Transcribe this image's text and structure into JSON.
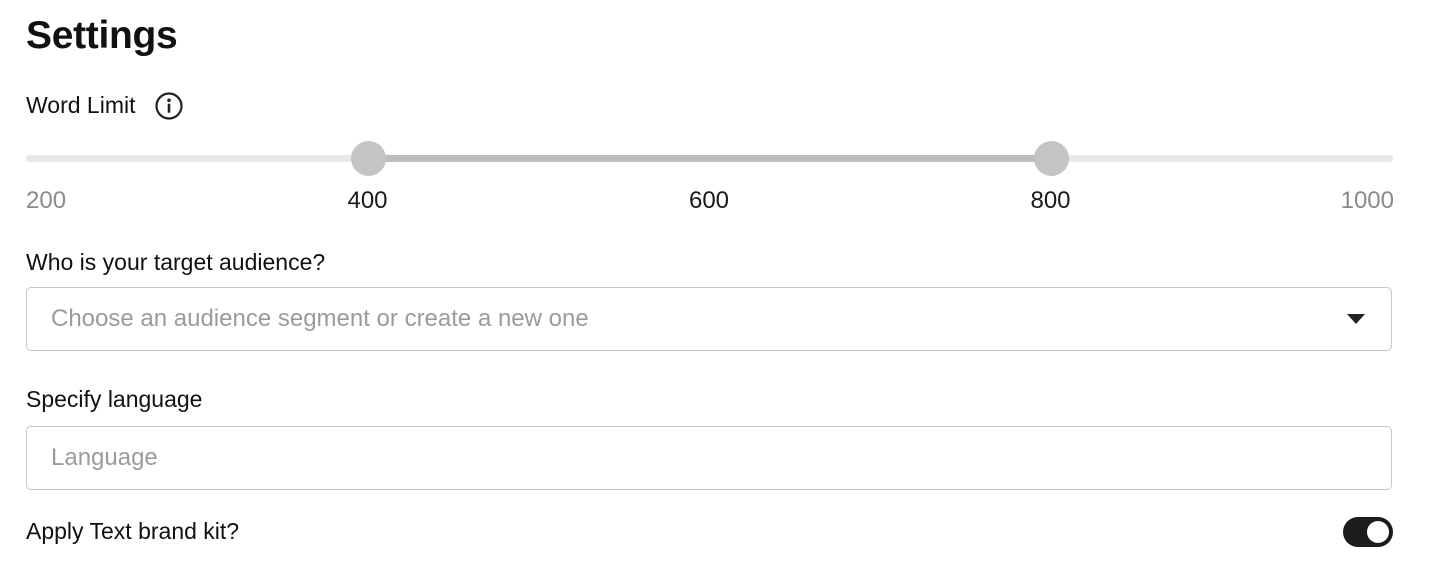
{
  "header": {
    "title": "Settings"
  },
  "word_limit": {
    "label": "Word Limit",
    "info_icon": "info-circle-icon",
    "min": 200,
    "max": 1000,
    "selected_low": 400,
    "selected_high": 800,
    "ticks": [
      {
        "label": "200",
        "value": 200,
        "in_range": false
      },
      {
        "label": "400",
        "value": 400,
        "in_range": true
      },
      {
        "label": "600",
        "value": 600,
        "in_range": true
      },
      {
        "label": "800",
        "value": 800,
        "in_range": true
      },
      {
        "label": "1000",
        "value": 1000,
        "in_range": false
      }
    ]
  },
  "audience": {
    "label": "Who is your target audience?",
    "placeholder": "Choose an audience segment or create a new one",
    "value": "",
    "caret_icon": "caret-down-icon"
  },
  "language": {
    "label": "Specify language",
    "placeholder": "Language",
    "value": ""
  },
  "brand_kit": {
    "label": "Apply Text brand kit?",
    "enabled": true
  },
  "colors": {
    "track": "#e8e8e8",
    "range": "#bdbdbd",
    "thumb": "#c4c4c4",
    "toggle_on": "#1c1c1c",
    "placeholder": "#9b9b9b",
    "border": "#c7c7c7"
  }
}
